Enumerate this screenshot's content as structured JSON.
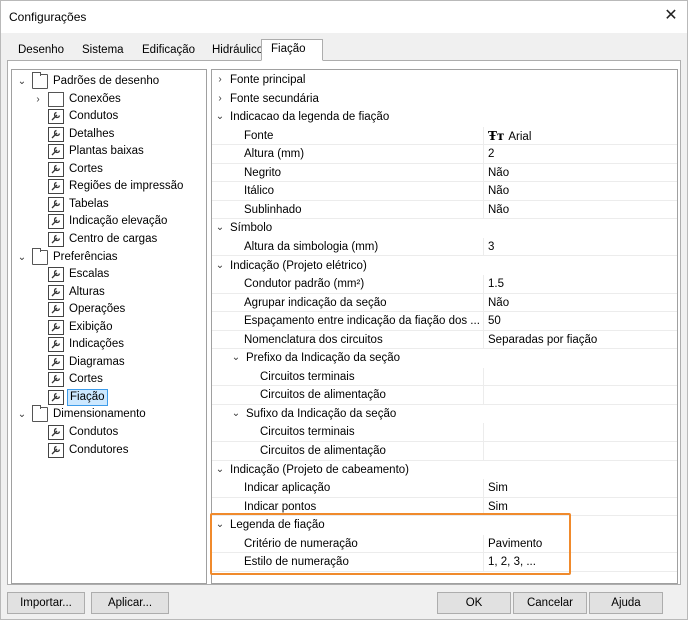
{
  "window": {
    "title": "Configurações",
    "close_glyph": "✕"
  },
  "tabs": [
    {
      "label": "Desenho"
    },
    {
      "label": "Sistema"
    },
    {
      "label": "Edificação"
    },
    {
      "label": "Hidráulico"
    },
    {
      "label": "Fiação",
      "active": true
    }
  ],
  "tree": {
    "nodes": [
      {
        "label": "Padrões de desenho",
        "icon": "folder-icon",
        "expanded": true,
        "level": 0
      },
      {
        "label": "Conexões",
        "icon": "page-icon",
        "expanded": false,
        "level": 1,
        "collapsible": true
      },
      {
        "label": "Condutos",
        "icon": "wrench-icon",
        "level": 1
      },
      {
        "label": "Detalhes",
        "icon": "wrench-icon",
        "level": 1
      },
      {
        "label": "Plantas baixas",
        "icon": "wrench-icon",
        "level": 1
      },
      {
        "label": "Cortes",
        "icon": "wrench-icon",
        "level": 1
      },
      {
        "label": "Regiões de impressão",
        "icon": "wrench-icon",
        "level": 1
      },
      {
        "label": "Tabelas",
        "icon": "wrench-icon",
        "level": 1
      },
      {
        "label": "Indicação elevação",
        "icon": "wrench-icon",
        "level": 1
      },
      {
        "label": "Centro de cargas",
        "icon": "wrench-icon",
        "level": 1
      },
      {
        "label": "Preferências",
        "icon": "folder-icon",
        "expanded": true,
        "level": 0
      },
      {
        "label": "Escalas",
        "icon": "wrench-icon",
        "level": 1
      },
      {
        "label": "Alturas",
        "icon": "wrench-icon",
        "level": 1
      },
      {
        "label": "Operações",
        "icon": "wrench-icon",
        "level": 1
      },
      {
        "label": "Exibição",
        "icon": "wrench-icon",
        "level": 1
      },
      {
        "label": "Indicações",
        "icon": "wrench-icon",
        "level": 1
      },
      {
        "label": "Diagramas",
        "icon": "wrench-icon",
        "level": 1
      },
      {
        "label": "Cortes",
        "icon": "wrench-icon",
        "level": 1
      },
      {
        "label": "Fiação",
        "icon": "wrench-icon",
        "level": 1,
        "selected": true
      },
      {
        "label": "Dimensionamento",
        "icon": "folder-icon",
        "expanded": true,
        "level": 0
      },
      {
        "label": "Condutos",
        "icon": "wrench-icon",
        "level": 1
      },
      {
        "label": "Condutores",
        "icon": "wrench-icon",
        "level": 1
      }
    ]
  },
  "grid": {
    "rows": [
      {
        "kind": "cat",
        "label": "Fonte principal",
        "expanded": false,
        "level": 0
      },
      {
        "kind": "cat",
        "label": "Fonte secundária",
        "expanded": false,
        "level": 0
      },
      {
        "kind": "cat",
        "label": "Indicacao da legenda de fiação",
        "expanded": true,
        "level": 0
      },
      {
        "kind": "prop",
        "label": "Fonte",
        "value": "Arial",
        "value_icon": "font-icon",
        "level": 1
      },
      {
        "kind": "prop",
        "label": "Altura (mm)",
        "value": "2",
        "level": 1
      },
      {
        "kind": "prop",
        "label": "Negrito",
        "value": "Não",
        "level": 1
      },
      {
        "kind": "prop",
        "label": "Itálico",
        "value": "Não",
        "level": 1
      },
      {
        "kind": "prop",
        "label": "Sublinhado",
        "value": "Não",
        "level": 1
      },
      {
        "kind": "cat",
        "label": "Símbolo",
        "expanded": true,
        "level": 0
      },
      {
        "kind": "prop",
        "label": "Altura da simbologia (mm)",
        "value": "3",
        "level": 1
      },
      {
        "kind": "cat",
        "label": "Indicação (Projeto elétrico)",
        "expanded": true,
        "level": 0
      },
      {
        "kind": "prop",
        "label": "Condutor padrão (mm²)",
        "value": "1.5",
        "level": 1
      },
      {
        "kind": "prop",
        "label": "Agrupar indicação da seção",
        "value": "Não",
        "level": 1
      },
      {
        "kind": "prop",
        "label": "Espaçamento entre indicação da fiação dos ...",
        "value": "50",
        "level": 1
      },
      {
        "kind": "prop",
        "label": "Nomenclatura dos circuitos",
        "value": "Separadas por fiação",
        "level": 1
      },
      {
        "kind": "cat",
        "label": "Prefixo da Indicação da seção",
        "expanded": true,
        "level": 1
      },
      {
        "kind": "prop",
        "label": "Circuitos terminais",
        "value": "",
        "level": 2
      },
      {
        "kind": "prop",
        "label": "Circuitos de alimentação",
        "value": "",
        "level": 2
      },
      {
        "kind": "cat",
        "label": "Sufixo da Indicação da seção",
        "expanded": true,
        "level": 1
      },
      {
        "kind": "prop",
        "label": "Circuitos terminais",
        "value": "",
        "level": 2
      },
      {
        "kind": "prop",
        "label": "Circuitos de alimentação",
        "value": "",
        "level": 2
      },
      {
        "kind": "cat",
        "label": "Indicação (Projeto de cabeamento)",
        "expanded": true,
        "level": 0
      },
      {
        "kind": "prop",
        "label": "Indicar aplicação",
        "value": "Sim",
        "level": 1
      },
      {
        "kind": "prop",
        "label": "Indicar pontos",
        "value": "Sim",
        "level": 1
      },
      {
        "kind": "cat",
        "label": "Legenda de fiação",
        "expanded": true,
        "level": 0
      },
      {
        "kind": "prop",
        "label": "Critério de numeração",
        "value": "Pavimento",
        "level": 1
      },
      {
        "kind": "prop",
        "label": "Estilo de numeração",
        "value": "1, 2, 3, ...",
        "level": 1
      }
    ],
    "highlight_color": "#f08a2c"
  },
  "buttons": {
    "import": "Importar...",
    "apply": "Aplicar...",
    "ok": "OK",
    "cancel": "Cancelar",
    "help": "Ajuda"
  },
  "glyphs": {
    "collapsed": "›",
    "expanded": "⌄"
  }
}
